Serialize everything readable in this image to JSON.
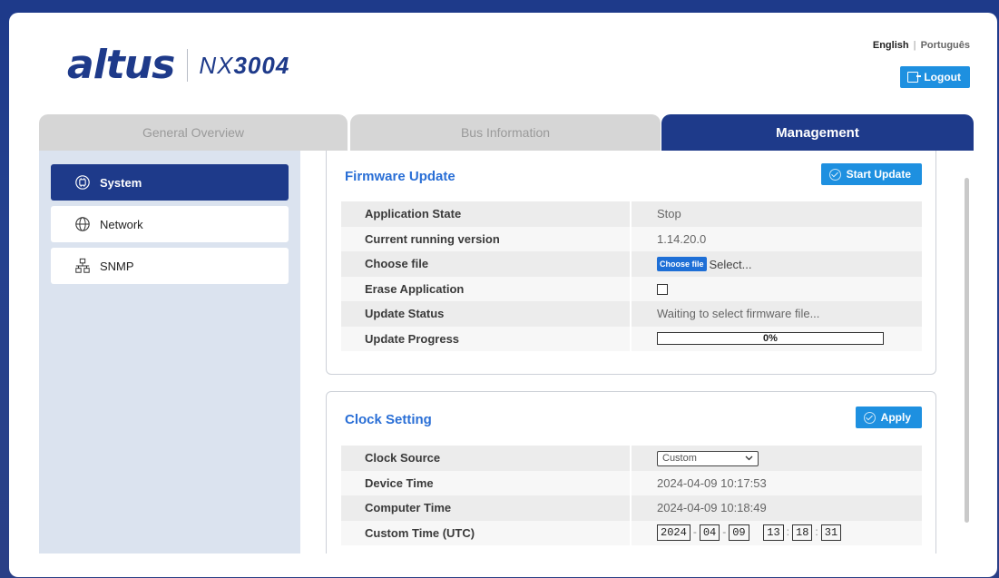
{
  "header": {
    "logo_brand": "altus",
    "logo_model_prefix": "NX",
    "logo_model_number": "3004",
    "lang_english": "English",
    "lang_separator": "|",
    "lang_portuguese": "Português",
    "logout_label": "Logout"
  },
  "tabs": [
    {
      "label": "General Overview",
      "active": false
    },
    {
      "label": "Bus Information",
      "active": false
    },
    {
      "label": "Management",
      "active": true
    }
  ],
  "sidebar": {
    "items": [
      {
        "label": "System",
        "icon": "chip-icon",
        "active": true
      },
      {
        "label": "Network",
        "icon": "globe-icon",
        "active": false
      },
      {
        "label": "SNMP",
        "icon": "network-tree-icon",
        "active": false
      }
    ]
  },
  "firmware": {
    "title": "Firmware Update",
    "button_label": "Start Update",
    "rows": {
      "app_state_label": "Application State",
      "app_state_value": "Stop",
      "version_label": "Current running version",
      "version_value": "1.14.20.0",
      "choose_label": "Choose file",
      "choose_button": "Choose file",
      "choose_text": "Select...",
      "erase_label": "Erase Application",
      "erase_checked": false,
      "status_label": "Update Status",
      "status_value": "Waiting to select firmware file...",
      "progress_label": "Update Progress",
      "progress_value": "0%",
      "progress_fraction": 0
    }
  },
  "clock": {
    "title": "Clock Setting",
    "button_label": "Apply",
    "rows": {
      "source_label": "Clock Source",
      "source_value": "Custom",
      "device_label": "Device Time",
      "device_value": "2024-04-09 10:17:53",
      "computer_label": "Computer Time",
      "computer_value": "2024-04-09 10:18:49",
      "custom_label": "Custom Time (UTC)",
      "custom_year": "2024",
      "custom_month": "04",
      "custom_day": "09",
      "custom_hour": "13",
      "custom_minute": "18",
      "custom_second": "31",
      "date_sep": "-",
      "time_sep": ":"
    }
  },
  "colors": {
    "brand_navy": "#1e3a8a",
    "button_blue": "#1e90e0",
    "title_blue": "#2a6fd6"
  }
}
